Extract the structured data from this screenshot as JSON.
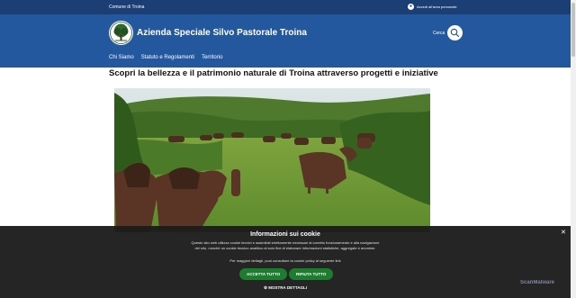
{
  "topbar": {
    "municipality": "Comune di Troina",
    "access_label": "Accedi all'area personale"
  },
  "header": {
    "brand": "Azienda Speciale Silvo Pastorale Troina",
    "search_label": "Cerca"
  },
  "nav": [
    "Chi Siamo",
    "Statuto e Regolamenti",
    "Territorio"
  ],
  "headline": "Scopri la bellezza e il patrimonio naturale di Troina attraverso progetti e iniziative",
  "cookie": {
    "title": "Informazioni sui cookie",
    "text1": "Questo sito web utilizza cookie tecnici e assimilati strettamente necessari al corretto funzionamento e alla navigazione del sito, nonché un cookie tecnico analitico al solo fine di elaborare informazioni statistiche, aggregate e anonime.",
    "text2": "Per maggiori dettagli, puoi consultare la cookie policy al seguente link",
    "accept_label": "ACCETTA TUTTO",
    "reject_label": "RIFIUTA TUTTO",
    "details_label": "MOSTRA DETTAGLI"
  },
  "watermark": "ScanMalware",
  "colors": {
    "topbar": "#1b3e74",
    "header": "#23589f",
    "cookie_button": "#1c7d2e"
  },
  "icons": [
    "user-icon",
    "tree-logo",
    "search-icon",
    "close-icon",
    "gear-icon"
  ]
}
